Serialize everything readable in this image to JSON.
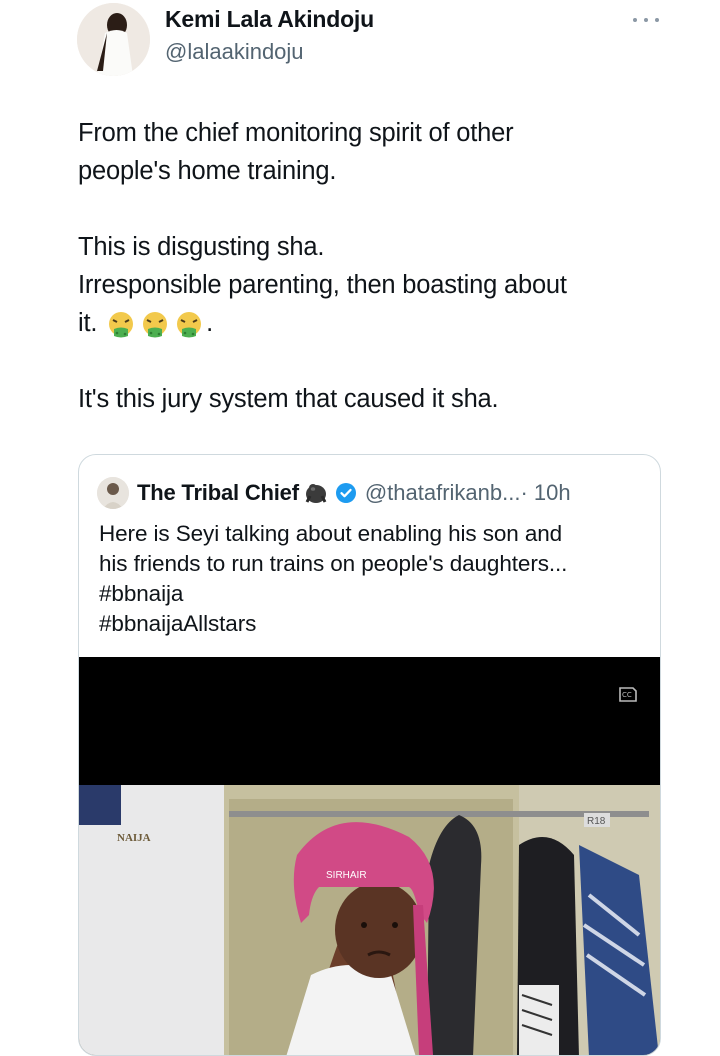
{
  "author": {
    "name": "Kemi Lala Akindoju",
    "handle": "@lalaakindoju"
  },
  "tweet": {
    "para1": [
      "From the chief monitoring spirit of other",
      "people's home training."
    ],
    "para2_line1": "This is disgusting sha.",
    "para2_line2": "Irresponsible parenting, then boasting about",
    "para2_line3": "it.",
    "para2_emoji_count": 3,
    "para2_end": ".",
    "para3": "It's this jury system that caused it sha."
  },
  "quoted": {
    "name": "The Tribal Chief",
    "handle": "@thatafrikanb...",
    "time": "· 10h",
    "text": [
      "Here is Seyi talking about enabling his son and",
      "his friends to run trains on people's daughters..."
    ],
    "hashtags": [
      "#bbnaija",
      "#bbnaijaAllstars"
    ],
    "media": {
      "cap_text": "SIRHAIR",
      "sign_text": "NAIJA",
      "rating": "R18"
    }
  },
  "icons": {
    "more": "more-horizontal-icon",
    "verified": "verified-badge-icon",
    "gorilla": "gorilla-emoji",
    "captions": "closed-captions-icon",
    "vomit": "face-vomiting-emoji"
  },
  "colors": {
    "verified_blue": "#1d9bf0",
    "secondary_text": "#536471",
    "border": "#cfd9de"
  }
}
